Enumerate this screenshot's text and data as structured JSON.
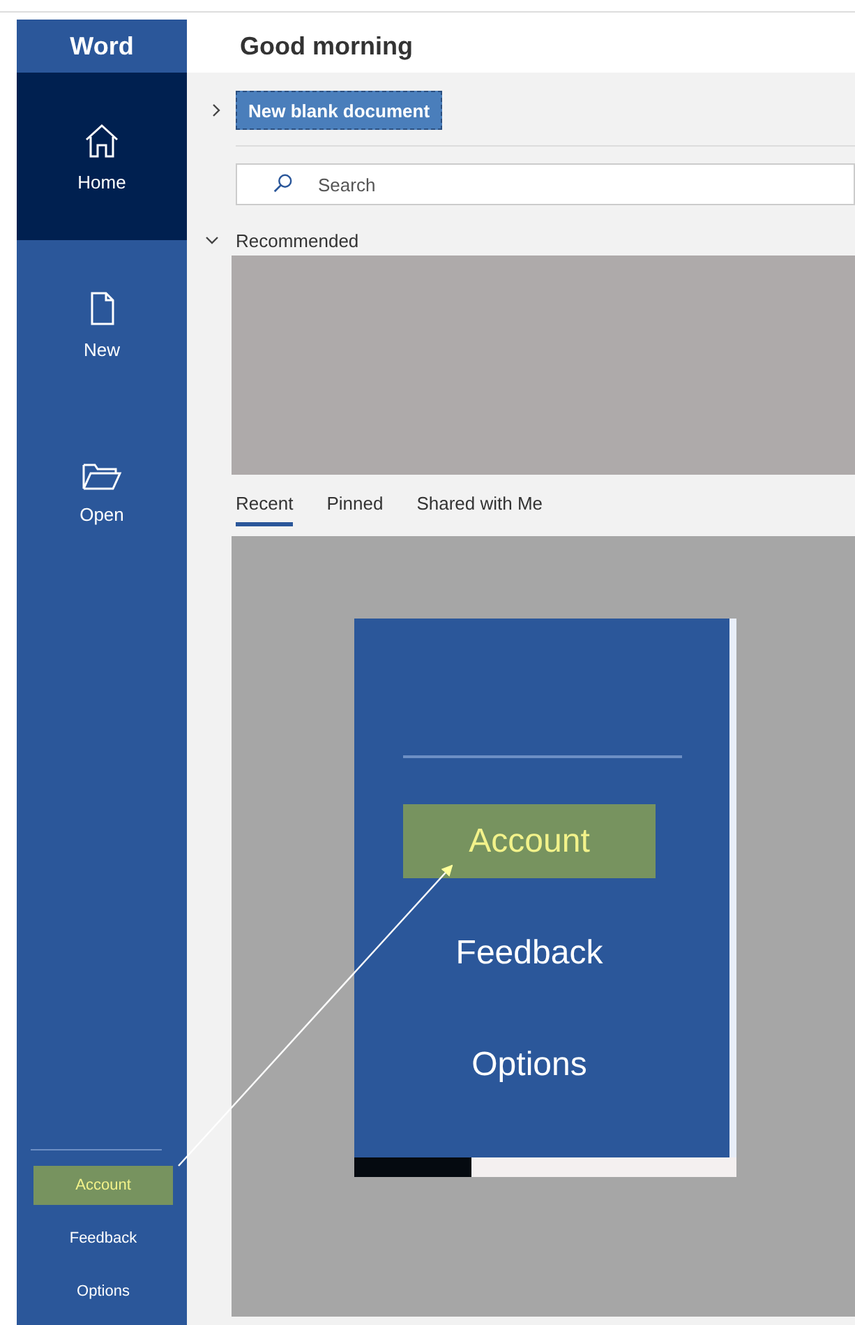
{
  "sidebar": {
    "title": "Word",
    "items": [
      {
        "label": "Home",
        "kind": "home",
        "selected": true
      },
      {
        "label": "New",
        "kind": "new",
        "selected": false
      },
      {
        "label": "Open",
        "kind": "open",
        "selected": false
      }
    ],
    "bottom_items": [
      {
        "label": "Account",
        "highlighted": true
      },
      {
        "label": "Feedback",
        "highlighted": false
      },
      {
        "label": "Options",
        "highlighted": false
      }
    ]
  },
  "header": {
    "greeting": "Good morning"
  },
  "new_blank_button": "New blank document",
  "search": {
    "placeholder": "Search"
  },
  "recommended": {
    "label": "Recommended",
    "expanded": true
  },
  "tabs": [
    {
      "label": "Recent",
      "selected": true
    },
    {
      "label": "Pinned",
      "selected": false
    },
    {
      "label": "Shared with Me",
      "selected": false
    }
  ],
  "zoom_inset": {
    "items": [
      {
        "label": "Account",
        "highlighted": true
      },
      {
        "label": "Feedback",
        "highlighted": false
      },
      {
        "label": "Options",
        "highlighted": false
      }
    ]
  }
}
